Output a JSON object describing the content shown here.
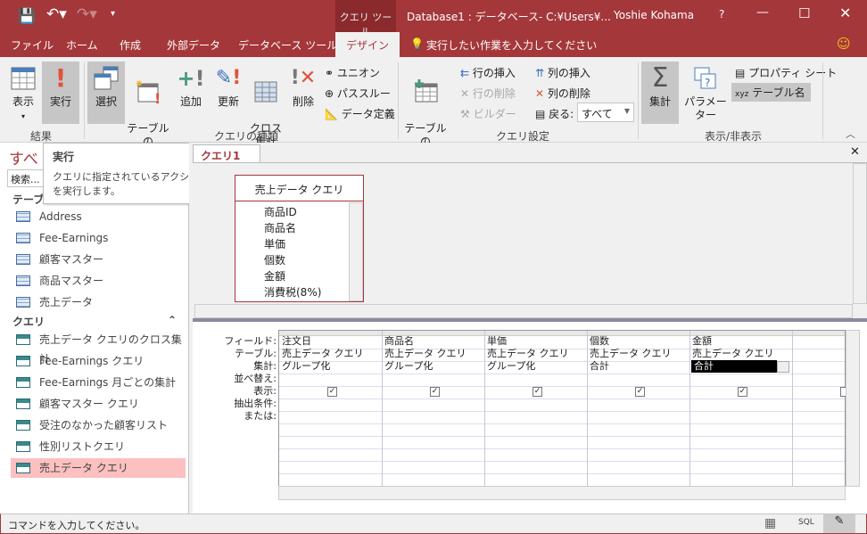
{
  "title": {
    "context_tab": "クエリ ツール",
    "doc": "Database1 : データベース- C:¥Users¥...",
    "user": "Yoshie Kohama",
    "help": "?"
  },
  "tabs": [
    "ファイル",
    "ホーム",
    "作成",
    "外部データ",
    "データベース ツール",
    "デザイン"
  ],
  "tell_me": "実行したい作業を入力してください",
  "ribbon": {
    "results": {
      "label": "結果",
      "view": "表示",
      "run": "実行"
    },
    "query_type": {
      "label": "クエリの種類",
      "select": "選択",
      "make_table": "テーブルの\n作成",
      "append": "追加",
      "update": "更新",
      "crosstab": "クロス\n集計",
      "delete": "削除",
      "union": "ユニオン",
      "passthrough": "パススルー",
      "data_definition": "データ定義"
    },
    "query_setup": {
      "label": "クエリ設定",
      "show_table": "テーブルの\n表示",
      "insert_rows": "行の挿入",
      "delete_rows": "行の削除",
      "builder": "ビルダー",
      "insert_columns": "列の挿入",
      "delete_columns": "列の削除",
      "return": "戻る:",
      "return_value": "すべて"
    },
    "show_hide": {
      "label": "表示/非表示",
      "totals": "集計",
      "parameters": "パラメーター",
      "property_sheet": "プロパティ シート",
      "table_names": "テーブル名"
    }
  },
  "tooltip": {
    "title": "実行",
    "body": "クエリに指定されているアクションを実行します。"
  },
  "nav": {
    "header": "すべ",
    "search_placeholder": "検索...",
    "tables_header": "テーブ",
    "tables": [
      "Address",
      "Fee-Earnings",
      "顧客マスター",
      "商品マスター",
      "売上データ"
    ],
    "queries_header": "クエリ",
    "queries": [
      "売上データ クエリのクロス集計",
      "Fee-Earnings クエリ",
      "Fee-Earnings 月ごとの集計",
      "顧客マスター クエリ",
      "受注のなかった顧客リスト",
      "性別リストクエリ",
      "売上データ クエリ"
    ],
    "selected": "売上データ クエリ"
  },
  "doc_tab": "クエリ1",
  "table_box": {
    "title": "売上データ クエリ",
    "fields": [
      "商品ID",
      "商品名",
      "単価",
      "個数",
      "金額",
      "消費税(8%)"
    ]
  },
  "grid": {
    "row_labels": [
      "フィールド:",
      "テーブル:",
      "集計:",
      "並べ替え:",
      "表示:",
      "抽出条件:",
      "または:"
    ],
    "columns": [
      {
        "field": "注文日",
        "table": "売上データ クエリ",
        "total": "グループ化",
        "show": true
      },
      {
        "field": "商品名",
        "table": "売上データ クエリ",
        "total": "グループ化",
        "show": true
      },
      {
        "field": "単価",
        "table": "売上データ クエリ",
        "total": "グループ化",
        "show": true
      },
      {
        "field": "個数",
        "table": "売上データ クエリ",
        "total": "合計",
        "show": true
      },
      {
        "field": "金額",
        "table": "売上データ クエリ",
        "total": "合計",
        "show": true,
        "selected": true
      },
      {
        "field": "",
        "table": "",
        "total": "",
        "show": false
      }
    ]
  },
  "status": {
    "text": "コマンドを入力してください。",
    "sql": "SQL"
  },
  "colors": {
    "accent": "#a4373a",
    "selected_nav": "#fcc0c0"
  }
}
